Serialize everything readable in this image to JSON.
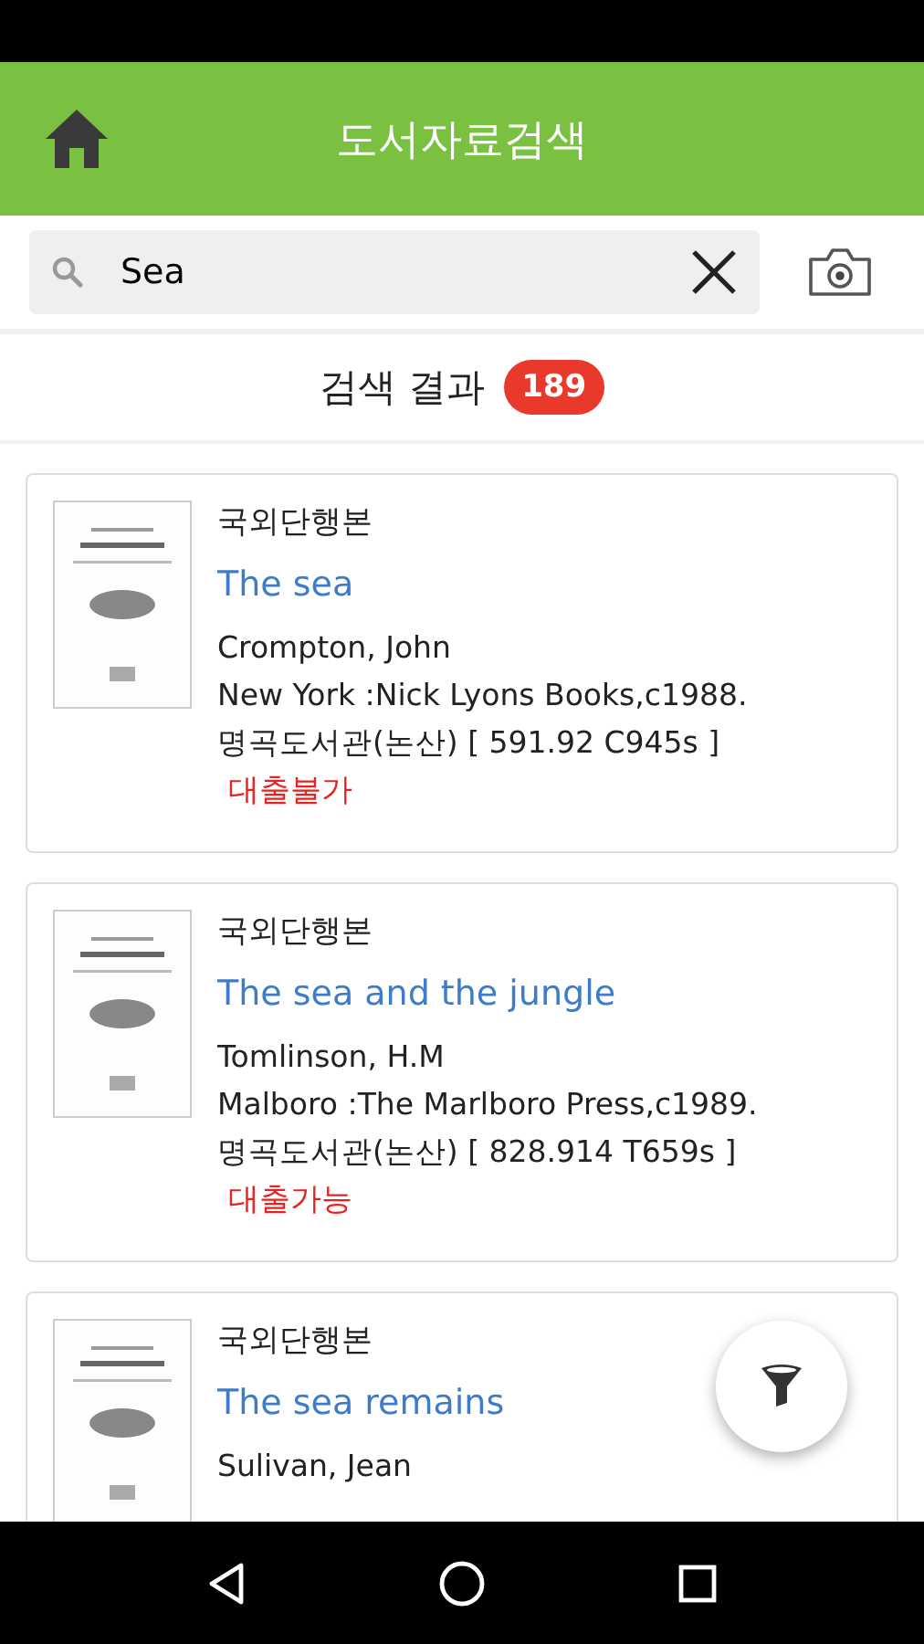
{
  "header": {
    "title": "도서자료검색"
  },
  "search": {
    "value": "Sea"
  },
  "results": {
    "label": "검색 결과",
    "count": "189"
  },
  "books": [
    {
      "type": "국외단행본",
      "title": "The sea",
      "author": "Crompton, John",
      "publisher": "New York :Nick Lyons Books,c1988.",
      "location": "명곡도서관(논산) [ 591.92 C945s ]",
      "status": "대출불가"
    },
    {
      "type": "국외단행본",
      "title": "The sea and the jungle",
      "author": "Tomlinson, H.M",
      "publisher": "Malboro :The Marlboro Press,c1989.",
      "location": "명곡도서관(논산) [ 828.914 T659s ]",
      "status": "대출가능"
    },
    {
      "type": "국외단행본",
      "title": "The sea remains",
      "author": "Sulivan, Jean"
    }
  ]
}
